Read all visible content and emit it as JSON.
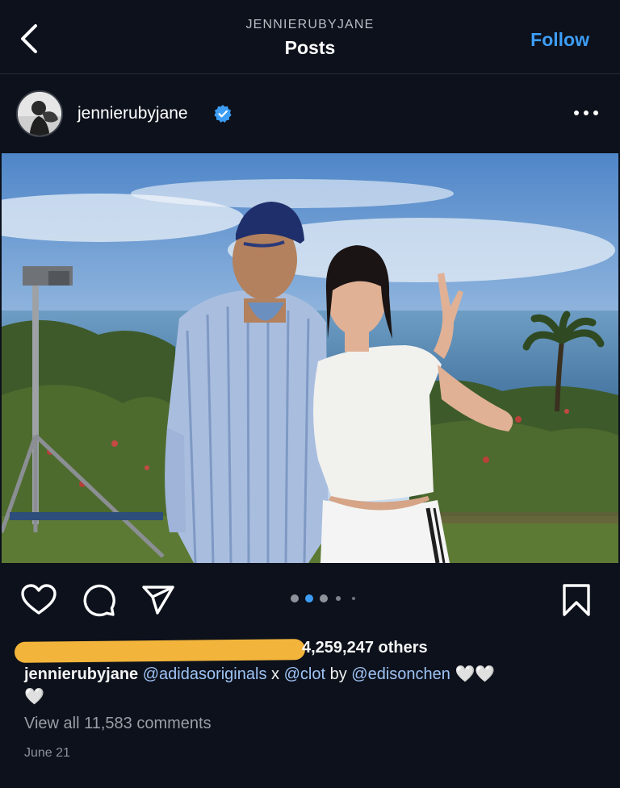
{
  "header": {
    "account": "JENNIERUBYJANE",
    "title": "Posts",
    "follow_label": "Follow"
  },
  "post": {
    "username": "jennierubyjane",
    "verified": true,
    "likes_text": "4,259,247 others",
    "likes_prefix_redacted": true,
    "caption": {
      "user": "jennierubyjane",
      "mention_1": "@adidasoriginals",
      "joiner_1": " x ",
      "mention_2": "@clot",
      "joiner_2": " by ",
      "mention_3": "@edisonchen",
      "hearts": "🤍🤍",
      "heart_wrap": "🤍"
    },
    "view_comments": "View all 11,583 comments",
    "date": "June 21",
    "carousel": {
      "count": 5,
      "active_index": 1
    }
  },
  "colors": {
    "background": "#0c111b",
    "follow": "#3d9df5",
    "mention": "#9fc3f5",
    "verified": "#3d9df5",
    "redaction": "#f2b43a",
    "carousel_active": "#3d9df5"
  },
  "icons": [
    "back-icon",
    "verified-badge-icon",
    "more-options-icon",
    "heart-icon",
    "comment-icon",
    "share-icon",
    "bookmark-icon"
  ]
}
